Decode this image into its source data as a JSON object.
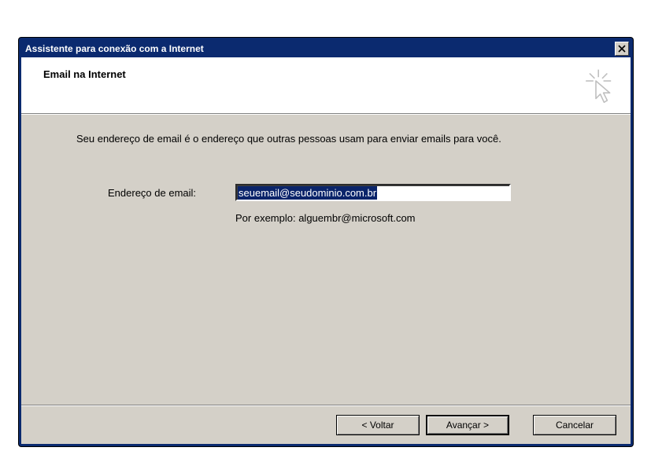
{
  "titlebar": {
    "title": "Assistente para conexão com a Internet"
  },
  "header": {
    "title": "Email na Internet"
  },
  "body": {
    "description": "Seu endereço de email é o endereço que outras pessoas usam para enviar emails para você.",
    "email_label": "Endereço de email:",
    "email_value": "seuemail@seudominio.com.br",
    "example_text": "Por exemplo: alguembr@microsoft.com"
  },
  "footer": {
    "back_label": "< Voltar",
    "next_label": "Avançar >",
    "cancel_label": "Cancelar"
  }
}
